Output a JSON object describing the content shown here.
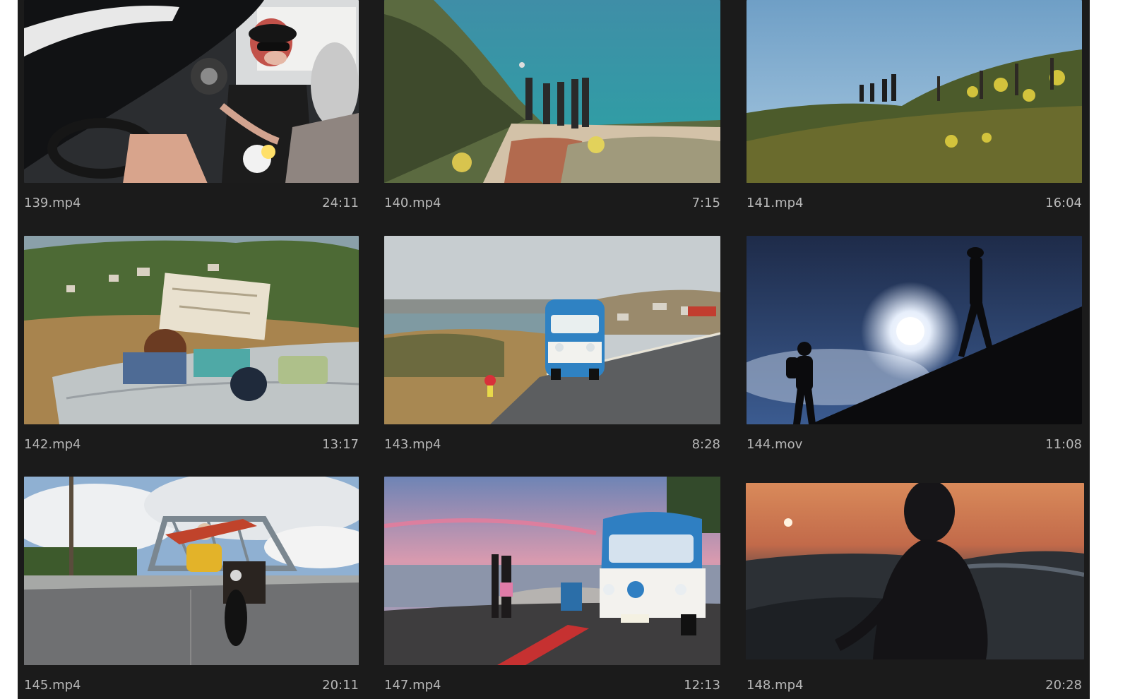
{
  "clips": [
    {
      "name": "139.mp4",
      "duration": "24:11",
      "icon": "thumbnail-convertible-car-friends"
    },
    {
      "name": "140.mp4",
      "duration": "7:15",
      "icon": "thumbnail-cliff-ocean-group"
    },
    {
      "name": "141.mp4",
      "duration": "16:04",
      "icon": "thumbnail-hilltop-hikers"
    },
    {
      "name": "142.mp4",
      "duration": "13:17",
      "icon": "thumbnail-picnic-map"
    },
    {
      "name": "143.mp4",
      "duration": "8:28",
      "icon": "thumbnail-blue-van-road"
    },
    {
      "name": "144.mov",
      "duration": "11:08",
      "icon": "thumbnail-silhouette-hikers-sun"
    },
    {
      "name": "145.mp4",
      "duration": "20:11",
      "icon": "thumbnail-motorcycle-bridge"
    },
    {
      "name": "147.mp4",
      "duration": "12:13",
      "icon": "thumbnail-van-sunset-couple"
    },
    {
      "name": "148.mp4",
      "duration": "20:28",
      "icon": "thumbnail-silhouette-sunset-woman"
    }
  ],
  "colors": {
    "panel_background": "#1b1b1b",
    "label_text": "#b7b7b7"
  }
}
